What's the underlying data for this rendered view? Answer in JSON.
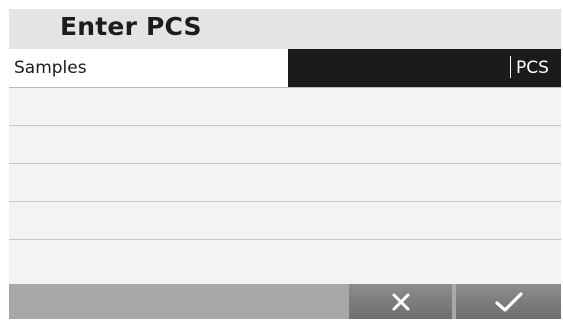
{
  "screen": {
    "title": "Enter PCS"
  },
  "form": {
    "samples_label": "Samples",
    "samples_value": "",
    "unit": "PCS"
  },
  "footer": {
    "cancel_icon": "close-icon",
    "confirm_icon": "checkmark-icon"
  },
  "colors": {
    "field_background": "#1b1b1b",
    "button_background": "#7a7a7a",
    "icon_color": "#ffffff"
  }
}
